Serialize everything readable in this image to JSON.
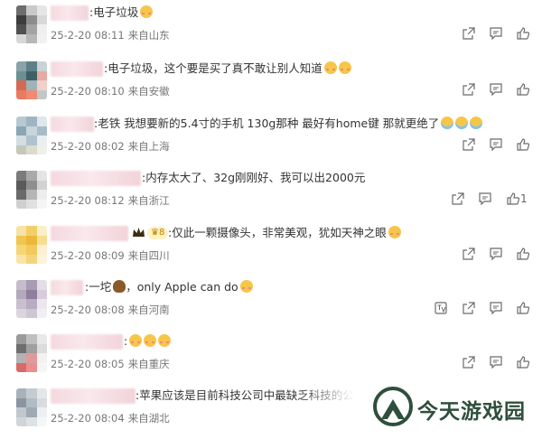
{
  "comments": [
    {
      "text": ":电子垃圾",
      "date": "25-2-20 08:11",
      "location": "来自山东",
      "likes": ""
    },
    {
      "text": ":电子垃圾，这个要是买了真不敢让别人知道",
      "date": "25-2-20 08:10",
      "location": "来自安徽",
      "likes": ""
    },
    {
      "text": ":老铁 我想要新的5.4寸的手机 130g那种 最好有home键 那就更绝了",
      "date": "25-2-20 08:02",
      "location": "来自上海",
      "likes": ""
    },
    {
      "text": ":内存太大了、32g刚刚好、我可以出2000元",
      "date": "25-2-20 08:12",
      "location": "来自浙江",
      "likes": "1"
    },
    {
      "text": ":仅此一颗摄像头，非常美观，犹如天神之眼",
      "date": "25-2-20 08:09",
      "location": "来自四川",
      "likes": "",
      "badge": "8"
    },
    {
      "text": ":一坨",
      "text_after": "，only Apple can do",
      "date": "25-2-20 08:08",
      "location": "来自河南",
      "likes": ""
    },
    {
      "text": ":",
      "date": "25-2-20 08:05",
      "location": "来自重庆",
      "likes": ""
    },
    {
      "text": ":苹果应该是目前科技公司中最缺乏科技的公司",
      "date": "25-2-20 08:04",
      "location": "来自湖北",
      "likes": ""
    }
  ],
  "watermark": {
    "brand": "今天游戏园"
  },
  "icons": {
    "share": "share-icon",
    "reply": "comment-icon",
    "like": "thumbs-up-icon",
    "translate": "translate-icon"
  },
  "colors": {
    "text": "#333333",
    "meta": "#777777",
    "icon": "#6b6b6b",
    "brand_green": "#2f4f3c"
  }
}
